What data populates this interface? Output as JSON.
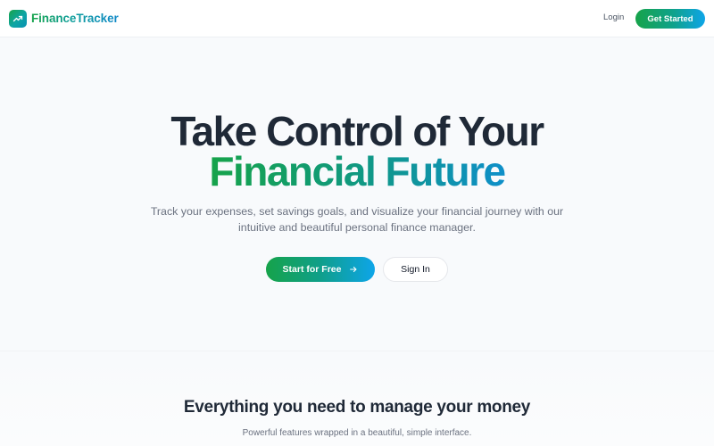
{
  "header": {
    "brand_name": "FinanceTracker",
    "logo_icon": "trending-up-icon",
    "login_label": "Login",
    "get_started_label": "Get Started"
  },
  "hero": {
    "title_line1": "Take Control of Your",
    "title_line2": "Financial Future",
    "subtitle": "Track your expenses, set savings goals, and visualize your financial journey with our intuitive and beautiful personal finance manager.",
    "primary_cta_label": "Start for Free",
    "primary_cta_icon": "arrow-right-icon",
    "secondary_cta_label": "Sign In"
  },
  "features": {
    "title": "Everything you need to manage your money",
    "subtitle": "Powerful features wrapped in a beautiful, simple interface."
  },
  "colors": {
    "brand_green": "#16a34a",
    "brand_teal": "#0d9488",
    "brand_blue": "#0ea5e9",
    "text_dark": "#1f2937",
    "text_muted": "#6b7280",
    "background": "#f8fafc"
  }
}
